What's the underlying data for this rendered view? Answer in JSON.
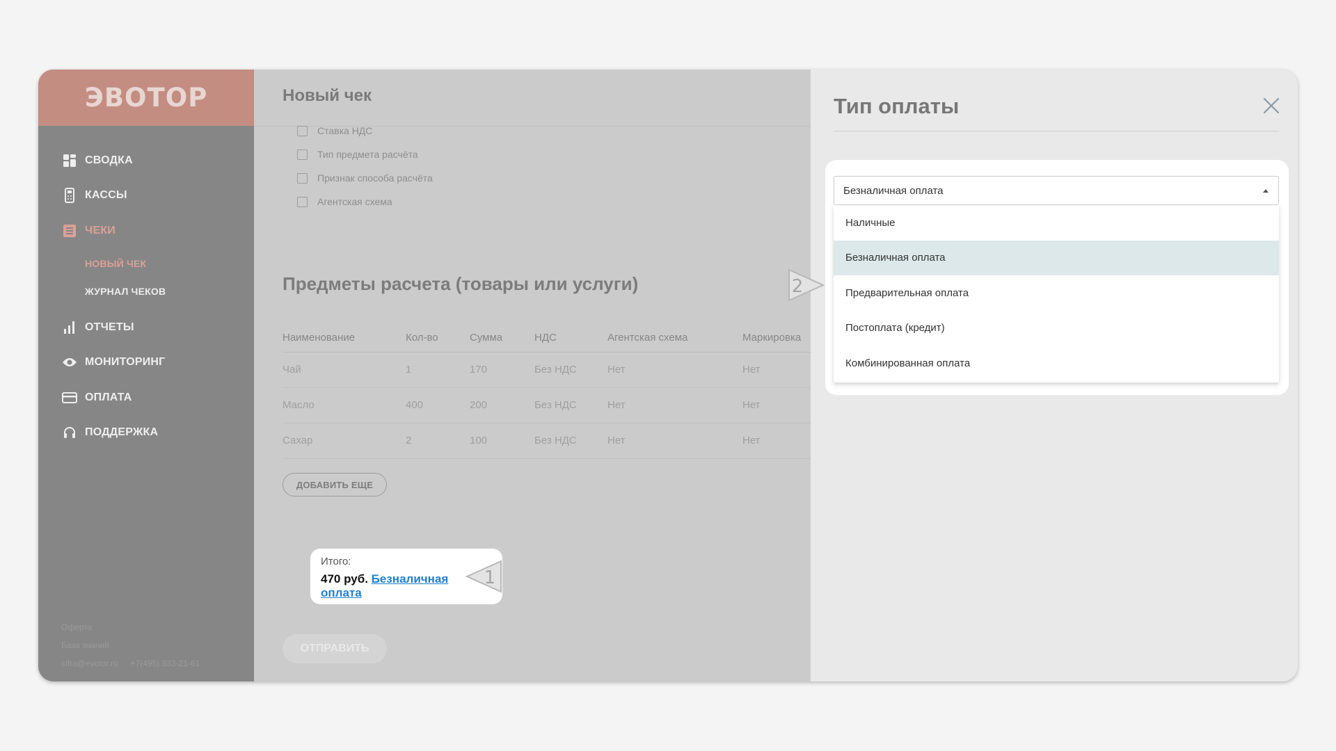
{
  "logo": "ЭВОТОР",
  "sidebar": {
    "items": [
      {
        "label": "СВОДКА",
        "icon": "dashboard-icon"
      },
      {
        "label": "КАССЫ",
        "icon": "cash-register-icon"
      },
      {
        "label": "ЧЕКИ",
        "icon": "receipt-icon",
        "active": true
      },
      {
        "label": "ОТЧЕТЫ",
        "icon": "bar-chart-icon"
      },
      {
        "label": "МОНИТОРИНГ",
        "icon": "eye-icon"
      },
      {
        "label": "ОПЛАТА",
        "icon": "credit-card-icon"
      },
      {
        "label": "ПОДДЕРЖКА",
        "icon": "headset-icon"
      }
    ],
    "sub_items": [
      {
        "label": "НОВЫЙ ЧЕК",
        "active": true
      },
      {
        "label": "ЖУРНАЛ ЧЕКОВ"
      }
    ],
    "footer": {
      "offer": "Оферта",
      "knowledge": "База знаний",
      "email": "cifra@evotor.ru",
      "phone": "+7(495) 933-21-61"
    }
  },
  "main": {
    "title": "Новый чек",
    "checkboxes": [
      "Ставка НДС",
      "Тип предмета расчёта",
      "Признак способа расчёта",
      "Агентская схема"
    ],
    "section_title": "Предметы расчета (товары или услуги)",
    "table": {
      "headers": [
        "Наименование",
        "Кол-во",
        "Сумма",
        "НДС",
        "Агентская схема",
        "Маркировка"
      ],
      "rows": [
        [
          "Чай",
          "1",
          "170",
          "Без НДС",
          "Нет",
          "Нет"
        ],
        [
          "Масло",
          "400",
          "200",
          "Без НДС",
          "Нет",
          "Нет"
        ],
        [
          "Сахар",
          "2",
          "100",
          "Без НДС",
          "Нет",
          "Нет"
        ]
      ]
    },
    "add_button": "ДОБАВИТЬ ЕЩЕ",
    "total_label": "Итого:",
    "total_amount": "470 руб.",
    "total_payment_link": "Безналичная оплата",
    "send_button": "ОТПРАВИТЬ"
  },
  "panel": {
    "title": "Тип оплаты",
    "selected": "Безналичная оплата",
    "options": [
      "Наличные",
      "Безналичная оплата",
      "Предварительная оплата",
      "Постоплата (кредит)",
      "Комбинированная оплата"
    ],
    "selected_index": 1
  },
  "callouts": [
    "1",
    "2"
  ],
  "colors": {
    "accent": "#c48d82",
    "link": "#1f7fd1",
    "selected_option": "#dde8ea"
  }
}
